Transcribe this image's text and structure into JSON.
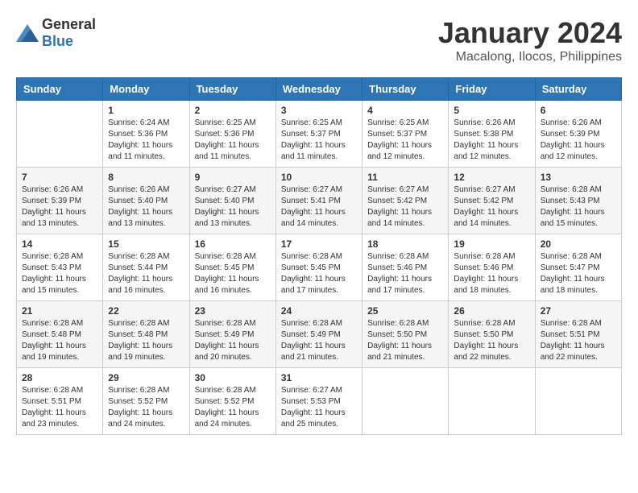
{
  "header": {
    "logo_general": "General",
    "logo_blue": "Blue",
    "month": "January 2024",
    "location": "Macalong, Ilocos, Philippines"
  },
  "calendar": {
    "days_of_week": [
      "Sunday",
      "Monday",
      "Tuesday",
      "Wednesday",
      "Thursday",
      "Friday",
      "Saturday"
    ],
    "weeks": [
      [
        {
          "day": "",
          "info": ""
        },
        {
          "day": "1",
          "info": "Sunrise: 6:24 AM\nSunset: 5:36 PM\nDaylight: 11 hours\nand 11 minutes."
        },
        {
          "day": "2",
          "info": "Sunrise: 6:25 AM\nSunset: 5:36 PM\nDaylight: 11 hours\nand 11 minutes."
        },
        {
          "day": "3",
          "info": "Sunrise: 6:25 AM\nSunset: 5:37 PM\nDaylight: 11 hours\nand 11 minutes."
        },
        {
          "day": "4",
          "info": "Sunrise: 6:25 AM\nSunset: 5:37 PM\nDaylight: 11 hours\nand 12 minutes."
        },
        {
          "day": "5",
          "info": "Sunrise: 6:26 AM\nSunset: 5:38 PM\nDaylight: 11 hours\nand 12 minutes."
        },
        {
          "day": "6",
          "info": "Sunrise: 6:26 AM\nSunset: 5:39 PM\nDaylight: 11 hours\nand 12 minutes."
        }
      ],
      [
        {
          "day": "7",
          "info": "Sunrise: 6:26 AM\nSunset: 5:39 PM\nDaylight: 11 hours\nand 13 minutes."
        },
        {
          "day": "8",
          "info": "Sunrise: 6:26 AM\nSunset: 5:40 PM\nDaylight: 11 hours\nand 13 minutes."
        },
        {
          "day": "9",
          "info": "Sunrise: 6:27 AM\nSunset: 5:40 PM\nDaylight: 11 hours\nand 13 minutes."
        },
        {
          "day": "10",
          "info": "Sunrise: 6:27 AM\nSunset: 5:41 PM\nDaylight: 11 hours\nand 14 minutes."
        },
        {
          "day": "11",
          "info": "Sunrise: 6:27 AM\nSunset: 5:42 PM\nDaylight: 11 hours\nand 14 minutes."
        },
        {
          "day": "12",
          "info": "Sunrise: 6:27 AM\nSunset: 5:42 PM\nDaylight: 11 hours\nand 14 minutes."
        },
        {
          "day": "13",
          "info": "Sunrise: 6:28 AM\nSunset: 5:43 PM\nDaylight: 11 hours\nand 15 minutes."
        }
      ],
      [
        {
          "day": "14",
          "info": "Sunrise: 6:28 AM\nSunset: 5:43 PM\nDaylight: 11 hours\nand 15 minutes."
        },
        {
          "day": "15",
          "info": "Sunrise: 6:28 AM\nSunset: 5:44 PM\nDaylight: 11 hours\nand 16 minutes."
        },
        {
          "day": "16",
          "info": "Sunrise: 6:28 AM\nSunset: 5:45 PM\nDaylight: 11 hours\nand 16 minutes."
        },
        {
          "day": "17",
          "info": "Sunrise: 6:28 AM\nSunset: 5:45 PM\nDaylight: 11 hours\nand 17 minutes."
        },
        {
          "day": "18",
          "info": "Sunrise: 6:28 AM\nSunset: 5:46 PM\nDaylight: 11 hours\nand 17 minutes."
        },
        {
          "day": "19",
          "info": "Sunrise: 6:28 AM\nSunset: 5:46 PM\nDaylight: 11 hours\nand 18 minutes."
        },
        {
          "day": "20",
          "info": "Sunrise: 6:28 AM\nSunset: 5:47 PM\nDaylight: 11 hours\nand 18 minutes."
        }
      ],
      [
        {
          "day": "21",
          "info": "Sunrise: 6:28 AM\nSunset: 5:48 PM\nDaylight: 11 hours\nand 19 minutes."
        },
        {
          "day": "22",
          "info": "Sunrise: 6:28 AM\nSunset: 5:48 PM\nDaylight: 11 hours\nand 19 minutes."
        },
        {
          "day": "23",
          "info": "Sunrise: 6:28 AM\nSunset: 5:49 PM\nDaylight: 11 hours\nand 20 minutes."
        },
        {
          "day": "24",
          "info": "Sunrise: 6:28 AM\nSunset: 5:49 PM\nDaylight: 11 hours\nand 21 minutes."
        },
        {
          "day": "25",
          "info": "Sunrise: 6:28 AM\nSunset: 5:50 PM\nDaylight: 11 hours\nand 21 minutes."
        },
        {
          "day": "26",
          "info": "Sunrise: 6:28 AM\nSunset: 5:50 PM\nDaylight: 11 hours\nand 22 minutes."
        },
        {
          "day": "27",
          "info": "Sunrise: 6:28 AM\nSunset: 5:51 PM\nDaylight: 11 hours\nand 22 minutes."
        }
      ],
      [
        {
          "day": "28",
          "info": "Sunrise: 6:28 AM\nSunset: 5:51 PM\nDaylight: 11 hours\nand 23 minutes."
        },
        {
          "day": "29",
          "info": "Sunrise: 6:28 AM\nSunset: 5:52 PM\nDaylight: 11 hours\nand 24 minutes."
        },
        {
          "day": "30",
          "info": "Sunrise: 6:28 AM\nSunset: 5:52 PM\nDaylight: 11 hours\nand 24 minutes."
        },
        {
          "day": "31",
          "info": "Sunrise: 6:27 AM\nSunset: 5:53 PM\nDaylight: 11 hours\nand 25 minutes."
        },
        {
          "day": "",
          "info": ""
        },
        {
          "day": "",
          "info": ""
        },
        {
          "day": "",
          "info": ""
        }
      ]
    ]
  }
}
